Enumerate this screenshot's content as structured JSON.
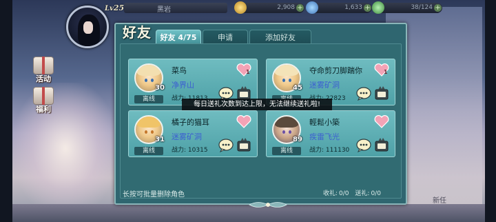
{
  "hud": {
    "level_prefix": "Lv",
    "level": "25",
    "player_name": "黑岩",
    "gold": "2,908",
    "gems": "1,633",
    "energy": "38/124",
    "plus_label": "+"
  },
  "side_menu": {
    "event_label": "活动",
    "welfare_label": "福利"
  },
  "right_side_label": "新任",
  "panel": {
    "title": "好友",
    "tabs": [
      {
        "label": "好友 4/75",
        "active": true
      },
      {
        "label": "申请",
        "active": false
      },
      {
        "label": "添加好友",
        "active": false
      }
    ],
    "friends": [
      {
        "name": "菜鸟",
        "level": "30",
        "status": "离线",
        "guild": "净界山",
        "power_label": "战力:",
        "power": "11813",
        "likes": "1"
      },
      {
        "name": "夺命剪刀脚踹你",
        "level": "45",
        "status": "离线",
        "guild": "迷雾矿洞",
        "power_label": "战力:",
        "power": "22823",
        "likes": "1"
      },
      {
        "name": "橘子的猫耳",
        "level": "31",
        "status": "离线",
        "guild": "迷雾矿洞",
        "power_label": "战力:",
        "power": "10315",
        "likes": ""
      },
      {
        "name": "輕鬆小築",
        "level": "89",
        "status": "离线",
        "guild": "疾雷飞光",
        "power_label": "战力:",
        "power": "111130",
        "likes": ""
      }
    ],
    "toast": "每日送礼次数到达上限，无法继续送礼啦!",
    "footer_hint": "长按可批量删除角色",
    "receive_label": "收礼:",
    "receive_value": "0/0",
    "send_label": "送礼:",
    "send_value": "0/0"
  },
  "colors": {
    "panel_bg": "#2f6670",
    "card_bg": "#6fbcc0",
    "tab_active": "#6fc1c6",
    "guild_text": "#3c5fd1",
    "heart": "#f2a3b6"
  }
}
